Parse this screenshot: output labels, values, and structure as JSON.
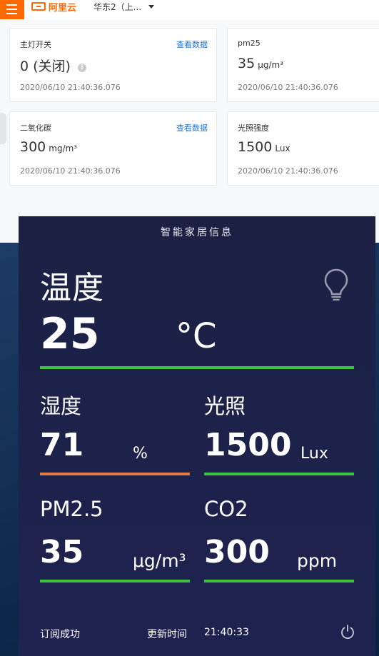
{
  "console": {
    "brand": "阿里云",
    "region": "华东2（上..."
  },
  "cards": [
    {
      "label": "主灯开关",
      "link": "查看数据",
      "value": "0 (关闭)",
      "unit": "",
      "time": "2020/06/10 21:40:36.076"
    },
    {
      "label": "pm25",
      "link": "",
      "value": "35",
      "unit": "μg/m³",
      "time": "2020/06/10 21:40:36.076"
    },
    {
      "label": "二氧化碳",
      "link": "查看数据",
      "value": "300",
      "unit": "mg/m³",
      "time": "2020/06/10 21:40:36.076"
    },
    {
      "label": "光照强度",
      "link": "",
      "value": "1500",
      "unit": "Lux",
      "time": "2020/06/10 21:40:36.076"
    }
  ],
  "dashboard": {
    "title": "智能家居信息",
    "temperature": {
      "label": "温度",
      "value": "25",
      "unit": "°C"
    },
    "humidity": {
      "label": "湿度",
      "value": "71",
      "unit": "%"
    },
    "light": {
      "label": "光照",
      "value": "1500",
      "unit": "Lux"
    },
    "pm25": {
      "label": "PM2.5",
      "value": "35",
      "unit": "μg/m³"
    },
    "co2": {
      "label": "CO2",
      "value": "300",
      "unit": "ppm"
    },
    "footer": {
      "status": "订阅成功",
      "update_label": "更新时间",
      "update_time": "21:40:33"
    }
  },
  "colors": {
    "accent_orange": "#ff6a00",
    "bar_green": "#3fc33f",
    "bar_orange": "#e07b45",
    "link_blue": "#2175d9"
  },
  "icons": {
    "menu": "hamburger-icon",
    "bulb": "light-bulb-icon",
    "power": "power-icon",
    "info": "info-icon"
  }
}
